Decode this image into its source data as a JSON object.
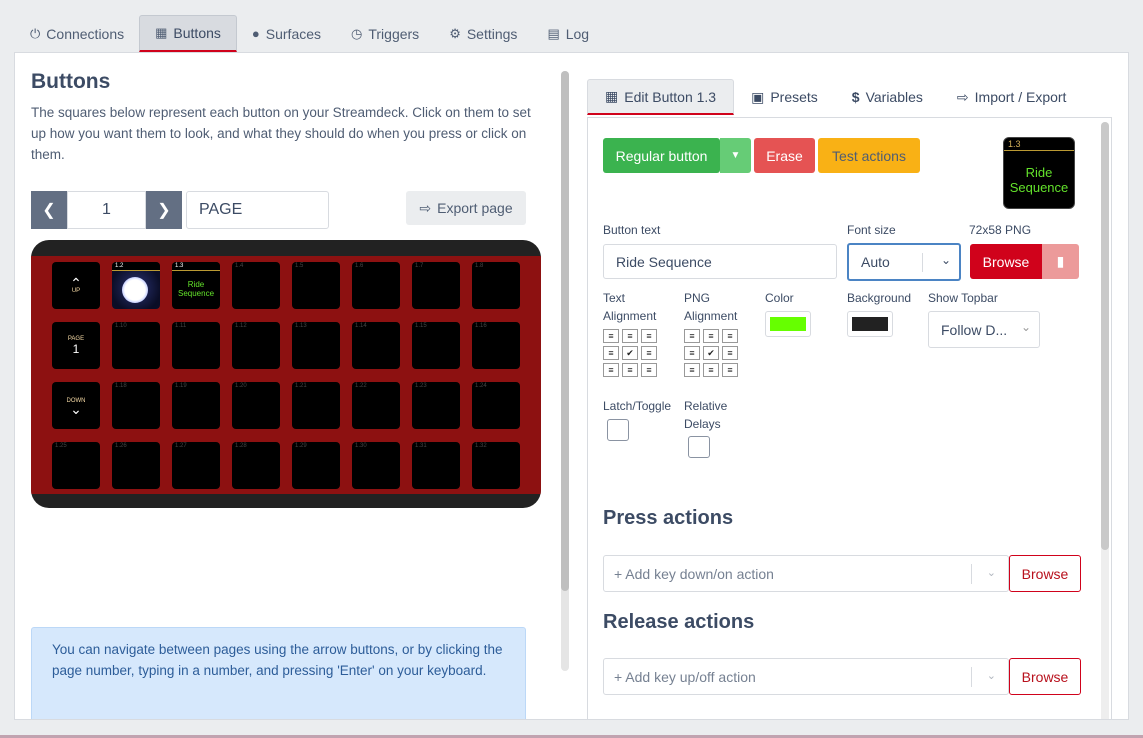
{
  "top_tabs": [
    {
      "label": "Connections",
      "icon": "plug-icon"
    },
    {
      "label": "Buttons",
      "icon": "calendar-grid-icon"
    },
    {
      "label": "Surfaces",
      "icon": "gamepad-icon"
    },
    {
      "label": "Triggers",
      "icon": "clock-icon"
    },
    {
      "label": "Settings",
      "icon": "user-cog-icon"
    },
    {
      "label": "Log",
      "icon": "clipboard-icon"
    }
  ],
  "left": {
    "title": "Buttons",
    "description": "The squares below represent each button on your Streamdeck. Click on them to set up how you want them to look, and what they should do when you press or click on them.",
    "page_number": "1",
    "page_name": "PAGE",
    "export_label": "Export page",
    "info": "You can navigate between pages using the arrow buttons, or by clicking the page number, typing in a number, and pressing 'Enter' on your keyboard."
  },
  "deck": {
    "nav_up": "UP",
    "nav_page_label": "PAGE",
    "nav_page_value": "1",
    "nav_down": "DOWN",
    "key_topbar": "1.2",
    "ride_topbar": "1.3",
    "ride_text": [
      "Ride",
      "Sequence"
    ],
    "key_numbers": [
      "1.4",
      "1.5",
      "1.6",
      "1.7",
      "1.8",
      "1.10",
      "1.11",
      "1.12",
      "1.13",
      "1.14",
      "1.15",
      "1.16",
      "1.18",
      "1.19",
      "1.20",
      "1.21",
      "1.22",
      "1.23",
      "1.24",
      "1.25",
      "1.26",
      "1.27",
      "1.28",
      "1.29",
      "1.30",
      "1.31",
      "1.32"
    ]
  },
  "right": {
    "tabs": [
      {
        "label": "Edit Button 1.3",
        "icon": "calculator-icon"
      },
      {
        "label": "Presets",
        "icon": "gift-icon"
      },
      {
        "label": "Variables",
        "icon": "dollar-icon"
      },
      {
        "label": "Import / Export",
        "icon": "file-import-icon"
      }
    ],
    "regular_button": "Regular button",
    "erase": "Erase",
    "test_actions": "Test actions",
    "preview_topbar": "1.3",
    "preview_text": [
      "Ride",
      "Sequence"
    ],
    "button_text_label": "Button text",
    "button_text_value": "Ride Sequence",
    "font_size_label": "Font size",
    "font_size_value": "Auto",
    "png_label": "72x58 PNG",
    "browse": "Browse",
    "text_alignment_label": [
      "Text",
      "Alignment"
    ],
    "png_alignment_label": [
      "PNG",
      "Alignment"
    ],
    "color_label": "Color",
    "color_value": "#66ff00",
    "background_label": "Background",
    "background_value": "#222222",
    "show_topbar_label": "Show Topbar",
    "show_topbar_value": "Follow D...",
    "latch_label": "Latch/Toggle",
    "relative_delays_label": [
      "Relative",
      "Delays"
    ],
    "press_actions_title": "Press actions",
    "press_placeholder": "+ Add key down/on action",
    "release_actions_title": "Release actions",
    "release_placeholder": "+ Add key up/off action"
  }
}
